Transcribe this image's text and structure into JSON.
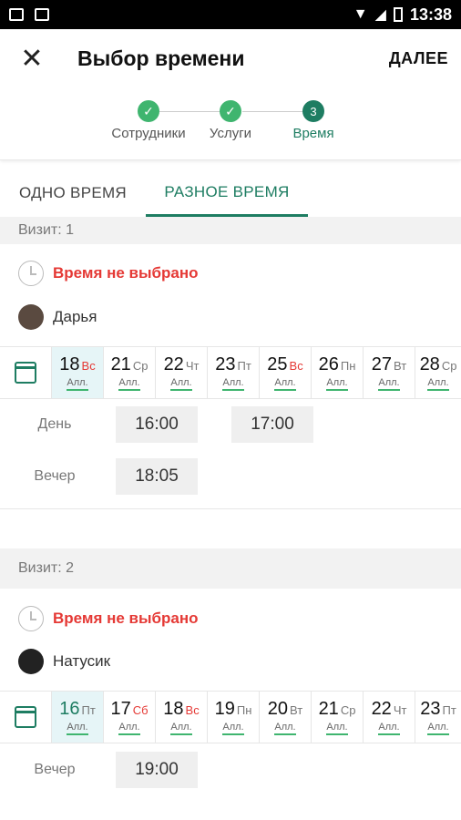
{
  "status_bar": {
    "time": "13:38"
  },
  "app_bar": {
    "close_symbol": "✕",
    "title": "Выбор времени",
    "next": "ДАЛЕЕ"
  },
  "stepper": {
    "steps": [
      {
        "label": "Сотрудники",
        "state": "done",
        "symbol": "✓"
      },
      {
        "label": "Услуги",
        "state": "done",
        "symbol": "✓"
      },
      {
        "label": "Время",
        "state": "current",
        "symbol": "3"
      }
    ]
  },
  "tabs": [
    {
      "label": "ОДНО ВРЕМЯ",
      "active": false
    },
    {
      "label": "РАЗНОЕ ВРЕМЯ",
      "active": true
    }
  ],
  "visits": [
    {
      "header": "Визит: 1",
      "status": "Время не выбрано",
      "person": "Дарья",
      "dates": [
        {
          "day": "18",
          "weekday": "Вс",
          "avail": "Алл.",
          "selected": true,
          "weekend": true
        },
        {
          "day": "21",
          "weekday": "Ср",
          "avail": "Алл."
        },
        {
          "day": "22",
          "weekday": "Чт",
          "avail": "Алл."
        },
        {
          "day": "23",
          "weekday": "Пт",
          "avail": "Алл."
        },
        {
          "day": "25",
          "weekday": "Вс",
          "avail": "Алл.",
          "weekend": true
        },
        {
          "day": "26",
          "weekday": "Пн",
          "avail": "Алл."
        },
        {
          "day": "27",
          "weekday": "Вт",
          "avail": "Алл."
        },
        {
          "day": "28",
          "weekday": "Ср",
          "avail": "Алл."
        }
      ],
      "periods": [
        {
          "label": "День",
          "slots": [
            "16:00",
            "17:00"
          ]
        },
        {
          "label": "Вечер",
          "slots": [
            "18:05"
          ]
        }
      ]
    },
    {
      "header": "Визит: 2",
      "status": "Время не выбрано",
      "person": "Натусик",
      "dates": [
        {
          "day": "16",
          "weekday": "Пт",
          "avail": "Алл.",
          "selected": true
        },
        {
          "day": "17",
          "weekday": "Сб",
          "avail": "Алл.",
          "weekend": true
        },
        {
          "day": "18",
          "weekday": "Вс",
          "avail": "Алл.",
          "weekend": true
        },
        {
          "day": "19",
          "weekday": "Пн",
          "avail": "Алл."
        },
        {
          "day": "20",
          "weekday": "Вт",
          "avail": "Алл."
        },
        {
          "day": "21",
          "weekday": "Ср",
          "avail": "Алл."
        },
        {
          "day": "22",
          "weekday": "Чт",
          "avail": "Алл."
        },
        {
          "day": "23",
          "weekday": "Пт",
          "avail": "Алл."
        }
      ],
      "periods": [
        {
          "label": "Вечер",
          "slots": [
            "19:00"
          ]
        }
      ]
    }
  ],
  "colors": {
    "primary": "#1e7d62",
    "done": "#3fb56f",
    "error": "#e53935",
    "selected_bg": "#e6f5f7"
  }
}
